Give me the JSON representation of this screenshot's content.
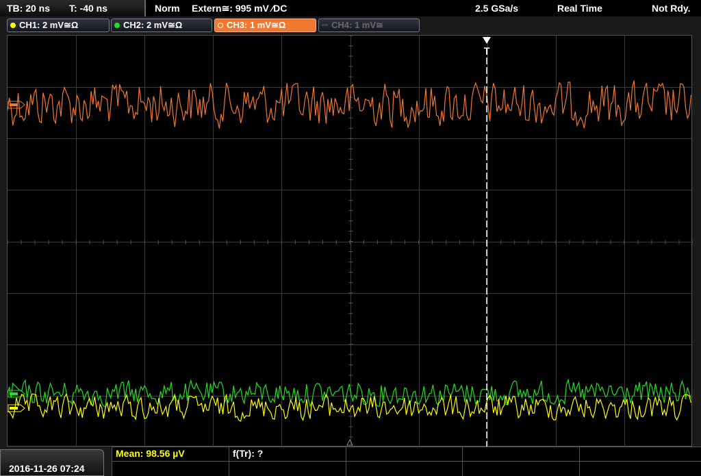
{
  "status_bar": {
    "timebase": "TB: 20 ns",
    "trigger_offset": "T: -40 ns",
    "trigger_mode": "Norm",
    "trigger_source": "Extern≅: 995 mV ∕DC",
    "sample_rate": "2.5 GSa/s",
    "acquisition_mode": "Real Time",
    "status": "Not Rdy."
  },
  "channels": [
    {
      "label": "CH1: 2 mV≅Ω",
      "color": "#ffff00",
      "active": true
    },
    {
      "label": "CH2: 2 mV≅Ω",
      "color": "#22dd22",
      "active": true
    },
    {
      "label": "CH3: 1 mV≅Ω",
      "color": "#f07830",
      "active": true,
      "selected": true
    },
    {
      "label": "CH4: 1 mV≅",
      "color": "#6a6a6a",
      "active": false
    }
  ],
  "trigger_marker": "T",
  "colors": {
    "ch1": "#ffff00",
    "ch2": "#22dd22",
    "ch3": "#f07830",
    "grid": "#3a3a3a",
    "trigger_line": "#ffffff"
  },
  "footer": {
    "datetime": "2016-11-26 07:24",
    "measurement_1": "Mean: 98.56 µV",
    "measurement_2": "f(Tr): ?"
  }
}
